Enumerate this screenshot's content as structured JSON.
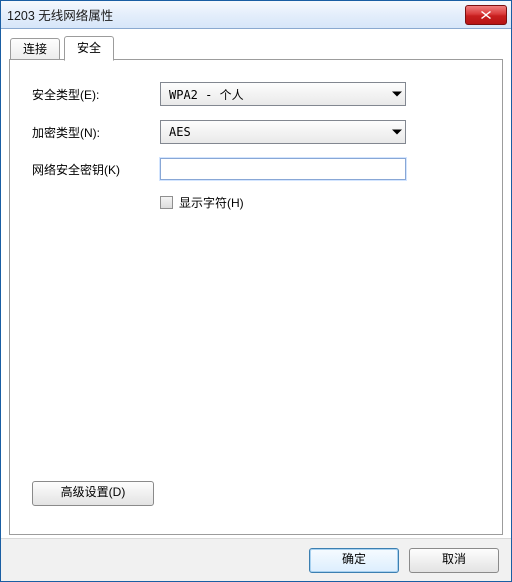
{
  "window": {
    "title": "1203 无线网络属性"
  },
  "tabs": {
    "connect": "连接",
    "security": "安全"
  },
  "labels": {
    "security_type": "安全类型(E):",
    "encryption_type": "加密类型(N):",
    "network_key": "网络安全密钥(K)",
    "show_chars": "显示字符(H)",
    "advanced": "高级设置(D)"
  },
  "values": {
    "security_type": "WPA2 - 个人",
    "encryption_type": "AES",
    "network_key": ""
  },
  "buttons": {
    "ok": "确定",
    "cancel": "取消"
  },
  "colors": {
    "window_border": "#1a5ea3",
    "close_bg": "#c71f1f",
    "focus_border": "#88a7d6"
  }
}
